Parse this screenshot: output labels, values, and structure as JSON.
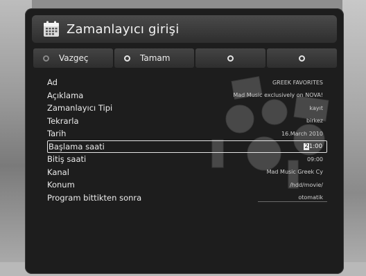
{
  "header": {
    "title": "Zamanlayıcı girişi",
    "icon": "calendar-icon"
  },
  "buttons": [
    {
      "label": "Vazgeç",
      "indicator": "gray"
    },
    {
      "label": "Tamam",
      "indicator": "white"
    },
    {
      "label": "",
      "indicator": "white"
    },
    {
      "label": "",
      "indicator": "white"
    }
  ],
  "fields": [
    {
      "label": "Ad",
      "value": "GREEK FAVORITES"
    },
    {
      "label": "Açıklama",
      "value": "Mad Music exclusively on NOVA!"
    },
    {
      "label": "Zamanlayıcı Tipi",
      "value": "kayıt"
    },
    {
      "label": "Tekrarla",
      "value": "birkez"
    },
    {
      "label": "Tarih",
      "value": "16.March 2010"
    },
    {
      "label": "Başlama saati",
      "value_cursor": "2",
      "value_rest": "1:00"
    },
    {
      "label": "Bitiş saati",
      "value": "09:00"
    },
    {
      "label": "Kanal",
      "value": "Mad Music Greek Cy"
    },
    {
      "label": "Konum",
      "value": "/hdd/movie/"
    },
    {
      "label": "Program bittikten sonra",
      "value": "otomatik"
    }
  ]
}
